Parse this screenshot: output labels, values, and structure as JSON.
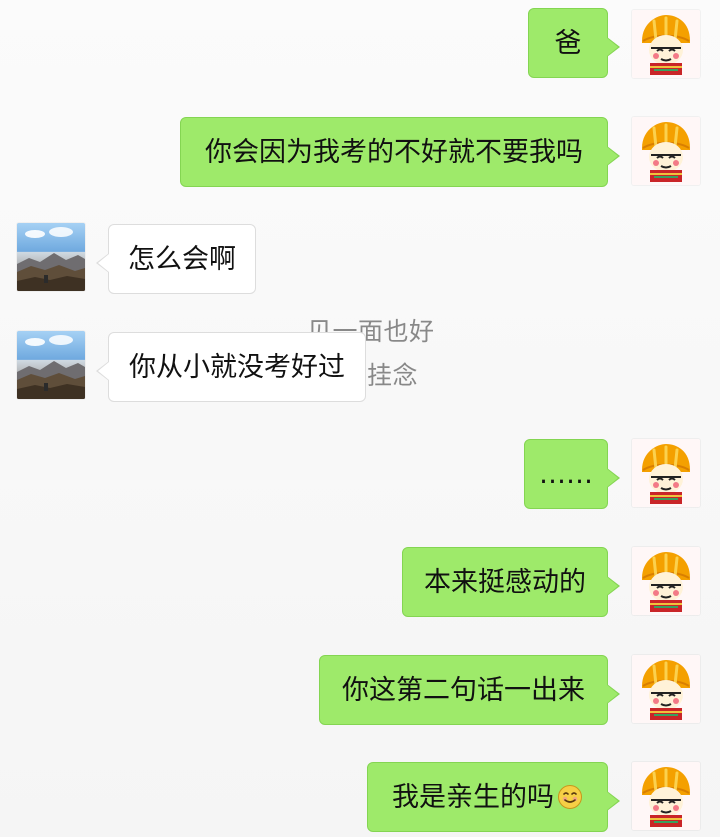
{
  "chat": {
    "messages": [
      {
        "side": "right",
        "text": "爸",
        "avatar_name": "girl-avatar-icon"
      },
      {
        "side": "right",
        "text": "你会因为我考的不好就不要我吗",
        "avatar_name": "girl-avatar-icon"
      },
      {
        "side": "left",
        "text": "怎么会啊",
        "avatar_name": "mountain-avatar-icon"
      },
      {
        "side": "left",
        "text": "你从小就没考好过",
        "avatar_name": "mountain-avatar-icon"
      },
      {
        "side": "right",
        "text": "……",
        "avatar_name": "girl-avatar-icon"
      },
      {
        "side": "right",
        "text": "本来挺感动的",
        "avatar_name": "girl-avatar-icon"
      },
      {
        "side": "right",
        "text": "你这第二句话一出来",
        "avatar_name": "girl-avatar-icon"
      },
      {
        "side": "right",
        "text": "我是亲生的吗",
        "emoji": "smile-emoji-icon",
        "avatar_name": "girl-avatar-icon"
      }
    ]
  },
  "background": {
    "ghost_text": [
      "见一面也好",
      "挂念"
    ]
  },
  "colors": {
    "right_bubble": "#9eea6a",
    "right_bubble_border": "#84d552",
    "left_bubble": "#ffffff",
    "left_bubble_border": "#dddddd",
    "background": "#f5f5f5"
  }
}
